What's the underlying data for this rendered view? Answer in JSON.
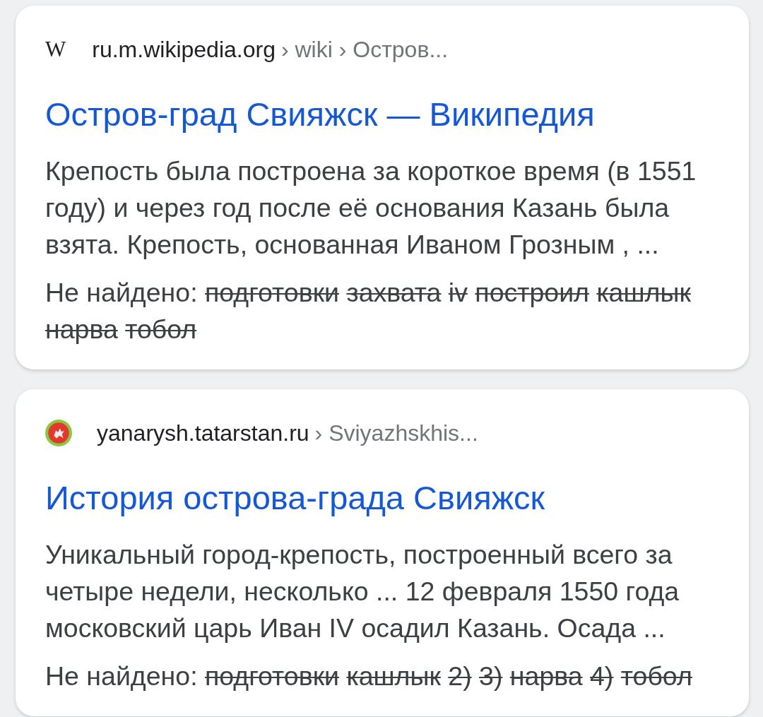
{
  "results": [
    {
      "favicon": {
        "kind": "letter",
        "text": "W"
      },
      "domain": "ru.m.wikipedia.org",
      "path": "› wiki › Остров...",
      "title": "Остров-град Свияжск — Википедия",
      "snippet": "Крепость была построена за короткое время (в 1551 году) и через год после её основания Казань была взята. Крепость, основанная Иваном Грозным , ...",
      "missing": {
        "label": "Не найдено:",
        "terms": [
          "подготовки",
          "захвата",
          "iv",
          "построил",
          "кашлык",
          "нарва",
          "тобол"
        ]
      }
    },
    {
      "favicon": {
        "kind": "emblem"
      },
      "domain": "yanarysh.tatarstan.ru",
      "path": "› Sviyazhskhis...",
      "title": "История острова-града Свияжск",
      "snippet": "Уникальный город-крепость, построенный всего за четыре недели, несколько ... 12 февраля 1550 года московский царь Иван IV осадил Казань. Осада ...",
      "missing": {
        "label": "Не найдено:",
        "terms": [
          "подготовки",
          "кашлык",
          "2)",
          "3)",
          "нарва",
          "4)",
          "тобол"
        ]
      }
    }
  ]
}
